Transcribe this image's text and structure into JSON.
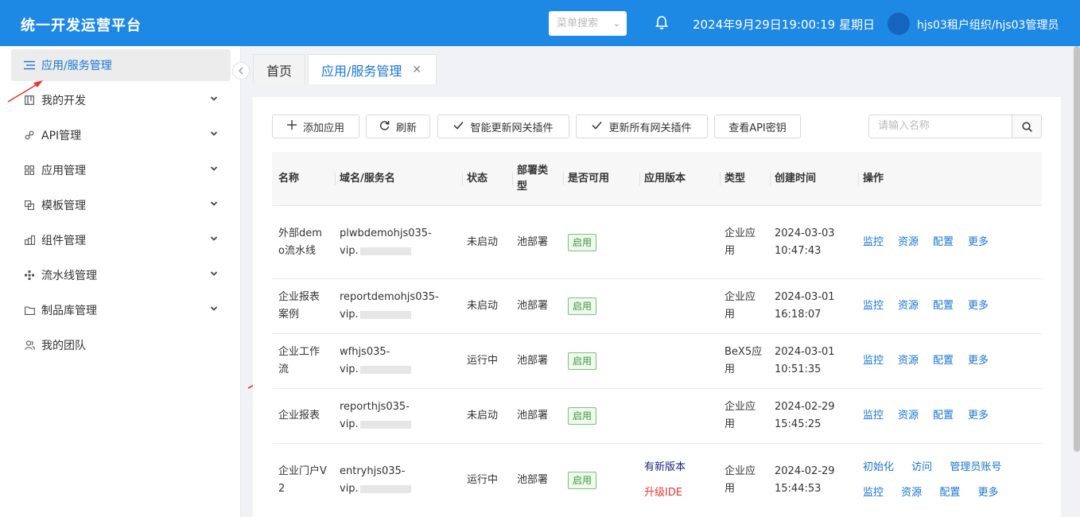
{
  "header": {
    "title": "统一开发运营平台",
    "menu_search_placeholder": "菜单搜索",
    "datetime": "2024年9月29日19:00:19 星期日",
    "user": "hjs03租户组织/hjs03管理员"
  },
  "sidebar": {
    "items": [
      {
        "label": "应用/服务管理",
        "icon": "list-icon",
        "active": true,
        "expandable": false
      },
      {
        "label": "我的开发",
        "icon": "board-icon",
        "expandable": true
      },
      {
        "label": "API管理",
        "icon": "link-icon",
        "expandable": true
      },
      {
        "label": "应用管理",
        "icon": "grid-icon",
        "expandable": true
      },
      {
        "label": "模板管理",
        "icon": "copy-icon",
        "expandable": true
      },
      {
        "label": "组件管理",
        "icon": "blocks-icon",
        "expandable": true
      },
      {
        "label": "流水线管理",
        "icon": "pipeline-icon",
        "expandable": true
      },
      {
        "label": "制品库管理",
        "icon": "folder-icon",
        "expandable": true
      },
      {
        "label": "我的团队",
        "icon": "team-icon",
        "expandable": false
      }
    ]
  },
  "tabs": [
    {
      "label": "首页"
    },
    {
      "label": "应用/服务管理",
      "active": true
    }
  ],
  "toolbar": {
    "add": "添加应用",
    "refresh": "刷新",
    "smart_update": "智能更新网关插件",
    "update_all": "更新所有网关插件",
    "view_key": "查看API密钥",
    "search_placeholder": "请输入名称"
  },
  "table": {
    "columns": [
      "名称",
      "域名/服务名",
      "状态",
      "部署类型",
      "是否可用",
      "应用版本",
      "类型",
      "创建时间",
      "操作"
    ],
    "rows": [
      {
        "name": "外部demo流水线",
        "domain1": "plwbdemohjs035-",
        "domain2": "vip.",
        "status": "未启动",
        "deploy": "池部署",
        "available": "启用",
        "version_new": "",
        "version_ide": "",
        "type": "企业应用",
        "date": "2024-03-03",
        "time": "10:47:43",
        "ops_top": [],
        "ops": [
          "监控",
          "资源",
          "配置",
          "更多"
        ]
      },
      {
        "name": "企业报表案例",
        "domain1": "reportdemohjs035-",
        "domain2": "vip.",
        "status": "未启动",
        "deploy": "池部署",
        "available": "启用",
        "version_new": "",
        "version_ide": "",
        "type": "企业应用",
        "date": "2024-03-01",
        "time": "16:18:07",
        "ops_top": [],
        "ops": [
          "监控",
          "资源",
          "配置",
          "更多"
        ]
      },
      {
        "name": "企业工作流",
        "domain1": "wfhjs035-",
        "domain2": "vip.",
        "status": "运行中",
        "deploy": "池部署",
        "available": "启用",
        "version_new": "",
        "version_ide": "",
        "type": "BeX5应用",
        "date": "2024-03-01",
        "time": "10:51:35",
        "ops_top": [],
        "ops": [
          "监控",
          "资源",
          "配置",
          "更多"
        ]
      },
      {
        "name": "企业报表",
        "domain1": "reporthjs035-",
        "domain2": "vip.",
        "status": "未启动",
        "deploy": "池部署",
        "available": "启用",
        "version_new": "",
        "version_ide": "",
        "type": "企业应用",
        "date": "2024-02-29",
        "time": "15:45:25",
        "ops_top": [],
        "ops": [
          "监控",
          "资源",
          "配置",
          "更多"
        ]
      },
      {
        "name": "企业门户V2",
        "domain1": "entryhjs035-",
        "domain2": "vip.",
        "status": "运行中",
        "deploy": "池部署",
        "available": "启用",
        "version_new": "有新版本",
        "version_ide": "升级IDE",
        "type": "企业应用",
        "date": "2024-02-29",
        "time": "15:44:53",
        "ops_top": [
          "初始化",
          "访问",
          "管理员账号"
        ],
        "ops": [
          "监控",
          "资源",
          "配置",
          "更多"
        ]
      }
    ]
  },
  "colors": {
    "header_bg": "#1e88e5",
    "accent": "#1976d2",
    "badge_green": "#3a9a3a",
    "new_version": "#1a237e",
    "upgrade_red": "#e53935",
    "arrow_red": "#e53935"
  }
}
